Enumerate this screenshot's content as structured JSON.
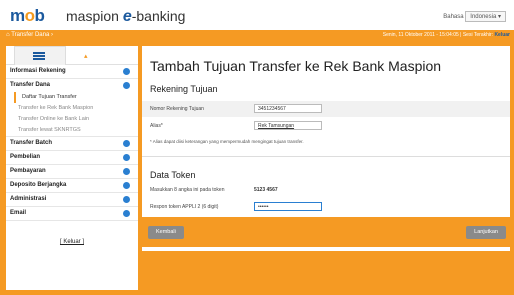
{
  "header": {
    "logo": "mob",
    "brand_prefix": "maspion",
    "brand_e": "e",
    "brand_suffix": "-banking",
    "language_label": "Bahasa",
    "language_value": "Indonesia"
  },
  "orangebar": {
    "breadcrumb": "Transfer Dana",
    "datetime": "Senin, 11 Oktober 2011 - 15:04:05",
    "logout_prefix": "Sesi Terakhir:",
    "logout_link": "Keluar"
  },
  "sidebar": {
    "sections": [
      {
        "label": "Informasi Rekening"
      },
      {
        "label": "Transfer Dana",
        "items": [
          {
            "label": "Daftar Tujuan Transfer",
            "active": true
          },
          {
            "label": "Transfer ke Rek Bank Maspion"
          },
          {
            "label": "Transfer Online ke Bank Lain"
          },
          {
            "label": "Transfer lewat SKNRTGS"
          }
        ]
      },
      {
        "label": "Transfer Batch"
      },
      {
        "label": "Pembelian"
      },
      {
        "label": "Pembayaran"
      },
      {
        "label": "Deposito Berjangka"
      },
      {
        "label": "Administrasi"
      },
      {
        "label": "Email"
      }
    ],
    "logout": "[ Keluar ]"
  },
  "main": {
    "title": "Tambah Tujuan Transfer ke Rek Bank Maspion",
    "rekening_heading": "Rekening Tujuan",
    "nomor_label": "Nomor Rekening Tujuan",
    "nomor_value": "3451234567",
    "alias_label": "Alias*",
    "alias_value": "Rek Tamsungan",
    "note": "* Alias dapat diisi keterangan yang mempermudah mengingat tujuan transfer.",
    "token_heading": "Data Token",
    "token_instr_label": "Masukkan 8 angka ini pada token",
    "token_code": "5123 4567",
    "respon_label": "Respon token APPLI 2 (6 digit)",
    "respon_value": "••••••"
  },
  "buttons": {
    "back": "Kembali",
    "next": "Lanjutkan"
  },
  "colors": {
    "accent_orange": "#f59a23",
    "brand_blue": "#1c5a9e",
    "dot_blue": "#2a7fd1"
  }
}
